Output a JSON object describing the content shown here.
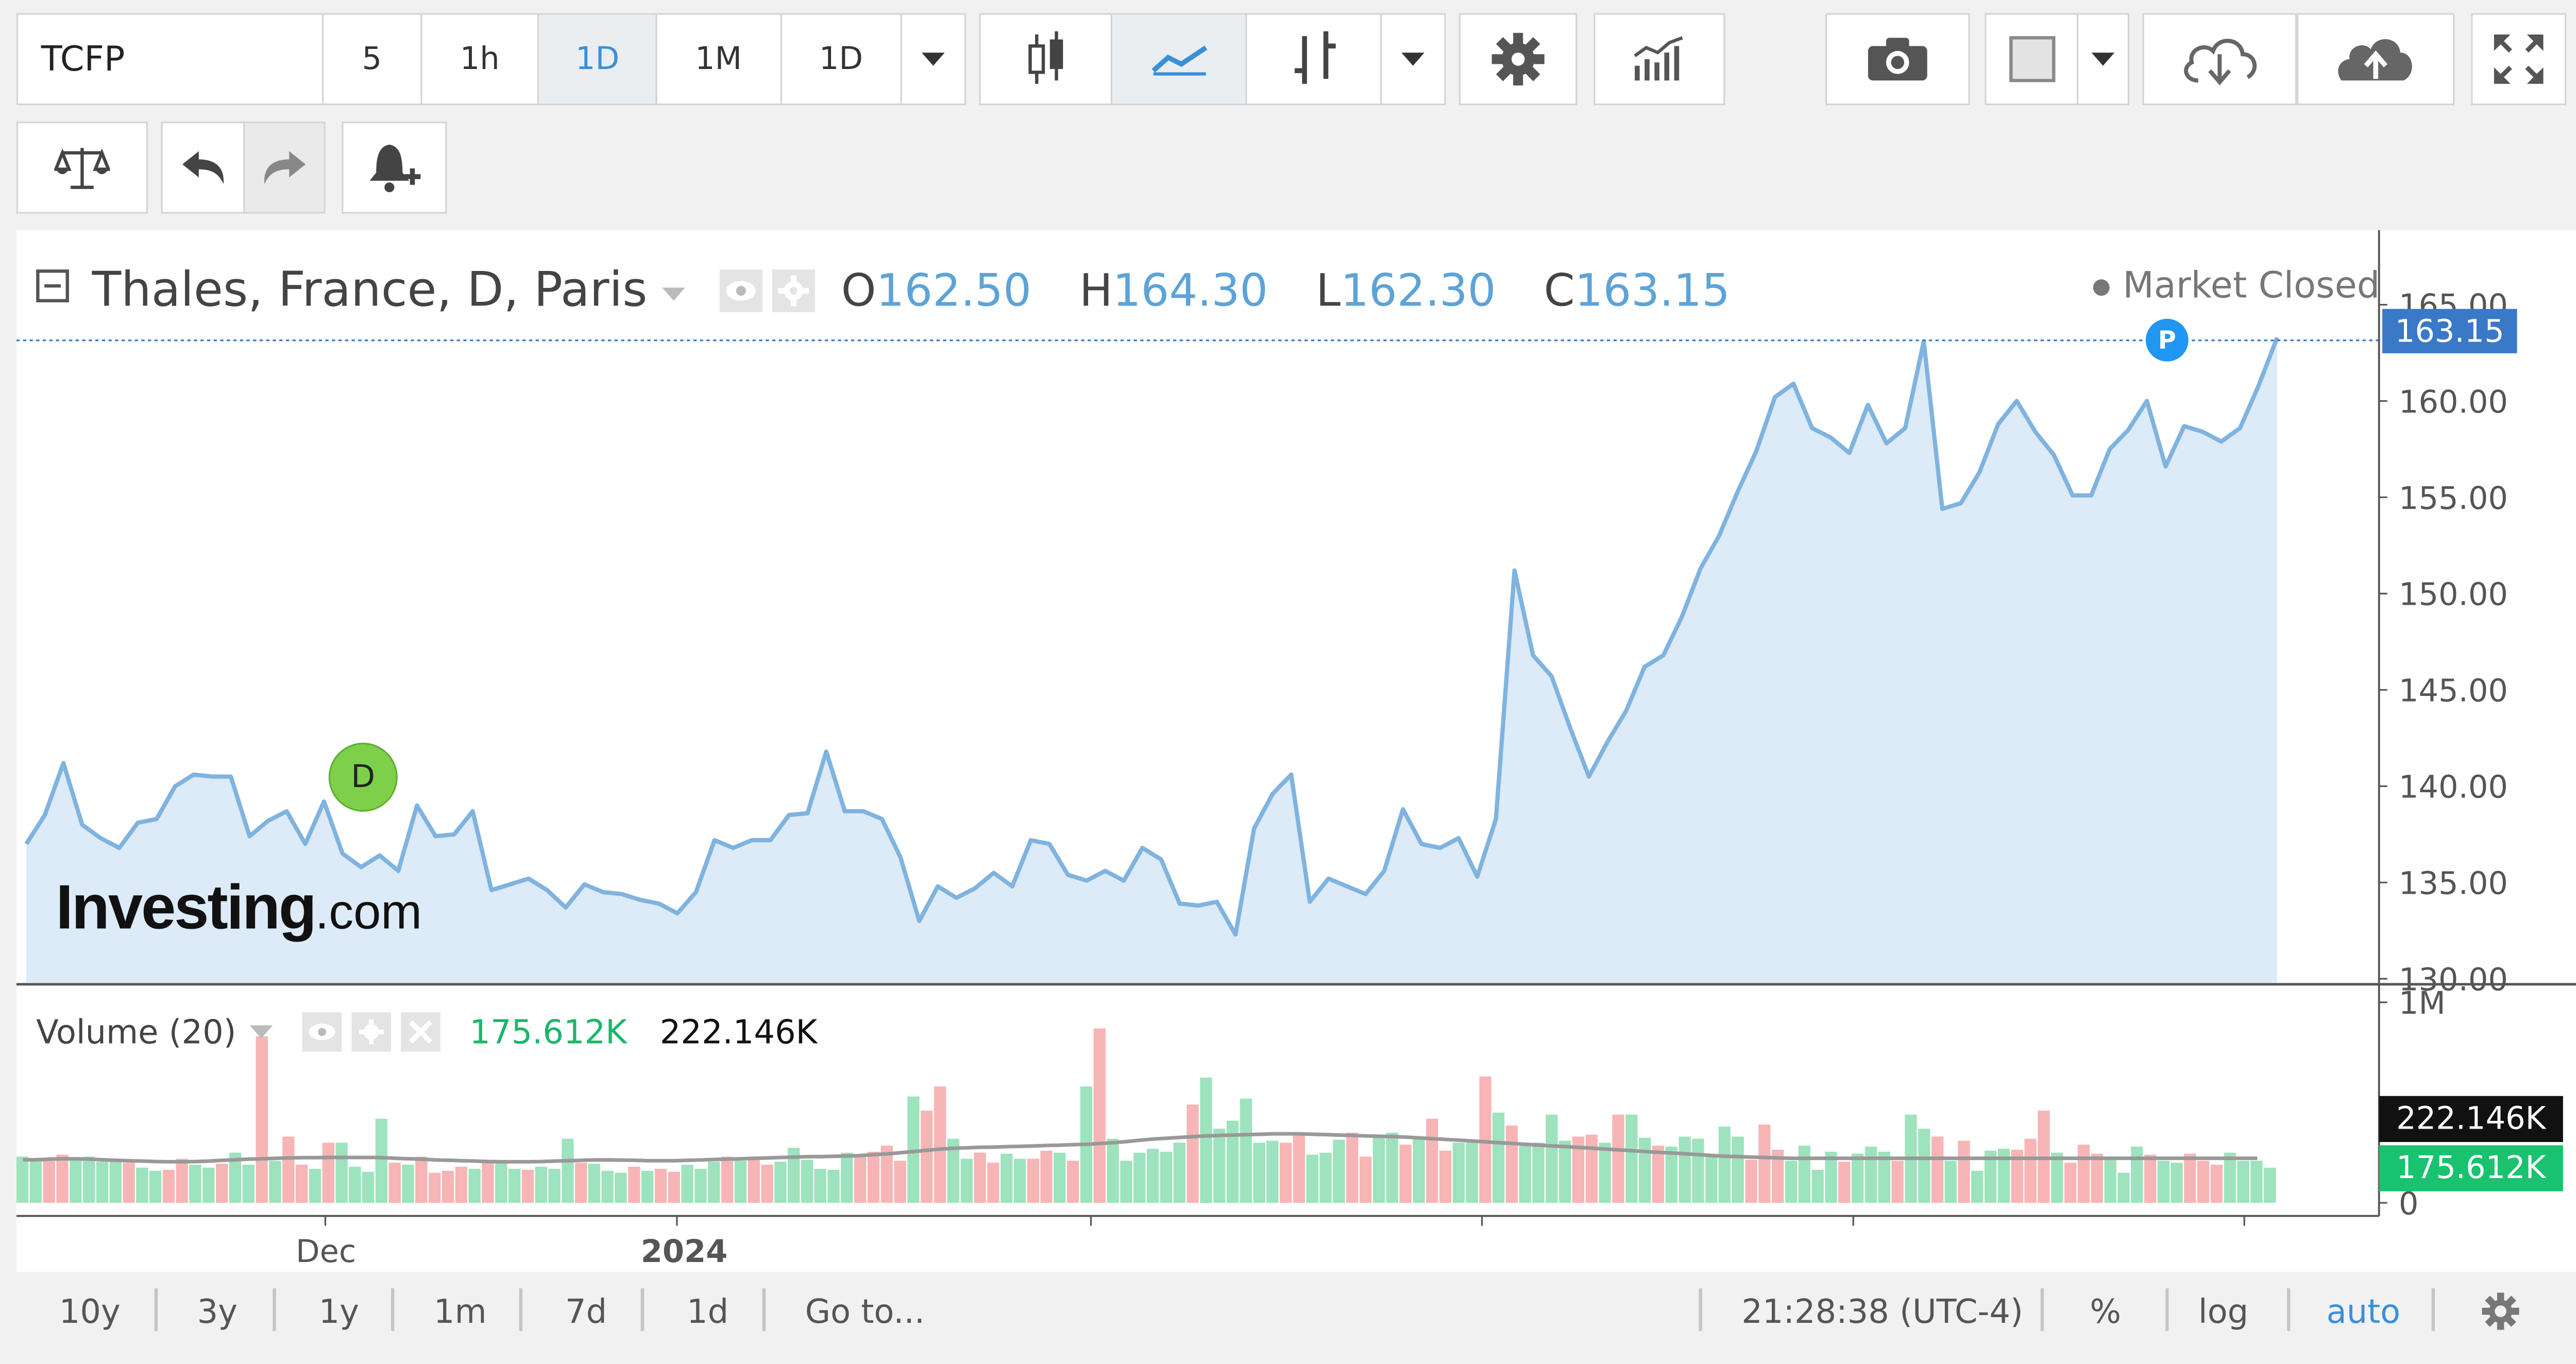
{
  "toolbar": {
    "symbol": "TCFP",
    "intervals": [
      "5",
      "1h",
      "1D",
      "1M",
      "1D"
    ],
    "active_interval_index": 2,
    "icons": [
      "candlestick-icon",
      "line-chart-icon",
      "bar-chart-icon",
      "chevron-down-icon",
      "gear-icon",
      "indicators-icon",
      "camera-icon",
      "color-swatch-icon",
      "chevron-down-icon",
      "cloud-download-icon",
      "cloud-upload-icon",
      "fullscreen-icon",
      "scales-icon",
      "undo-icon",
      "redo-icon",
      "add-alert-icon"
    ]
  },
  "legend": {
    "title": "Thales, France, D, Paris",
    "o_label": "O",
    "o_value": "162.50",
    "h_label": "H",
    "h_value": "164.30",
    "l_label": "L",
    "l_value": "162.30",
    "c_label": "C",
    "c_value": "163.15",
    "market_status": "Market Closed"
  },
  "watermark": {
    "brand": "Investing",
    "suffix": ".com"
  },
  "volume_legend": {
    "label": "Volume (20)",
    "value1": "175.612K",
    "value2": "222.146K"
  },
  "markers": {
    "d_label": "D",
    "p_label": "P"
  },
  "price_badge": "163.15",
  "volume_badges": {
    "ma": "222.146K",
    "last": "175.612K"
  },
  "bottom": {
    "ranges": [
      "10y",
      "3y",
      "1y",
      "1m",
      "7d",
      "1d"
    ],
    "goto": "Go to...",
    "time": "21:28:38 (UTC-4)",
    "percent": "%",
    "log": "log",
    "auto": "auto"
  },
  "colors": {
    "line": "#7fb3e0",
    "area": "#ddeaf7",
    "vol_up": "#9de3bd",
    "vol_down": "#f7b5b5",
    "accent": "#3a8fd9",
    "green_badge": "#19c26e"
  },
  "chart_data": [
    {
      "type": "area",
      "title": "Thales, France, D, Paris",
      "y_ticks": [
        "165.00",
        "160.00",
        "155.00",
        "150.00",
        "145.00",
        "140.00",
        "135.00",
        "130.00"
      ],
      "ylim": [
        129.8,
        167.0
      ],
      "x_ticks": [
        "Dec",
        "2024"
      ],
      "last_value": 163.15,
      "close": [
        137.0,
        138.5,
        141.2,
        138.0,
        137.3,
        136.8,
        138.1,
        138.3,
        140.0,
        140.6,
        140.5,
        140.5,
        137.4,
        138.2,
        138.7,
        137.0,
        139.2,
        136.5,
        135.8,
        136.4,
        135.6,
        139.0,
        137.4,
        137.5,
        138.7,
        134.6,
        134.9,
        135.2,
        134.6,
        133.7,
        134.9,
        134.5,
        134.4,
        134.1,
        133.9,
        133.4,
        134.5,
        137.2,
        136.8,
        137.2,
        137.2,
        138.5,
        138.6,
        141.8,
        138.7,
        138.7,
        138.3,
        136.3,
        133.0,
        134.8,
        134.2,
        134.7,
        135.5,
        134.8,
        137.2,
        137.0,
        135.4,
        135.1,
        135.6,
        135.1,
        136.8,
        136.2,
        133.9,
        133.8,
        134.0,
        132.3,
        137.8,
        139.6,
        140.6,
        134.0,
        135.2,
        134.8,
        134.4,
        135.6,
        138.8,
        137.0,
        136.8,
        137.3,
        135.3,
        138.3,
        151.2,
        146.8,
        145.7,
        143.0,
        140.5,
        142.3,
        143.9,
        146.2,
        146.8,
        148.8,
        151.3,
        153.0,
        155.3,
        157.4,
        160.2,
        160.9,
        158.6,
        158.1,
        157.3,
        159.8,
        157.8,
        158.6,
        163.1,
        154.4,
        154.7,
        156.3,
        158.8,
        160.0,
        158.4,
        157.2,
        155.1,
        155.1,
        157.5,
        158.5,
        160.0,
        156.6,
        158.7,
        158.4,
        157.9,
        158.6,
        160.8,
        163.3
      ],
      "volume_scale_max": 1000000,
      "volume_ma_value": 222146,
      "volume_last_value": 175612
    },
    {
      "type": "bar",
      "title": "Volume (20)",
      "y_ticks": [
        "1M",
        "0"
      ],
      "ylim": [
        0,
        1000000
      ],
      "volume_k": [
        230,
        210,
        215,
        240,
        225,
        230,
        205,
        210,
        200,
        175,
        160,
        165,
        220,
        190,
        175,
        195,
        250,
        190,
        830,
        210,
        330,
        190,
        170,
        300,
        300,
        180,
        155,
        420,
        200,
        190,
        230,
        150,
        160,
        180,
        170,
        200,
        200,
        170,
        165,
        180,
        170,
        320,
        200,
        195,
        160,
        150,
        180,
        160,
        170,
        155,
        190,
        170,
        205,
        230,
        210,
        215,
        190,
        205,
        275,
        215,
        170,
        165,
        250,
        240,
        255,
        285,
        210,
        530,
        460,
        580,
        320,
        220,
        250,
        200,
        245,
        220,
        220,
        260,
        250,
        210,
        580,
        870,
        320,
        210,
        250,
        270,
        255,
        300,
        490,
        625,
        370,
        410,
        520,
        300,
        310,
        300,
        335,
        240,
        250,
        315,
        350,
        230,
        330,
        350,
        290,
        330,
        420,
        260,
        300,
        310,
        630,
        450,
        385,
        295,
        300,
        440,
        310,
        330,
        340,
        300,
        440,
        440,
        325,
        285,
        280,
        330,
        320,
        240,
        380,
        330,
        215,
        390,
        265,
        210,
        285,
        165,
        255,
        205,
        245,
        280,
        255,
        210,
        440,
        370,
        330,
        210,
        310,
        160,
        260,
        270,
        265,
        320,
        460,
        250,
        200,
        290,
        245,
        220,
        150,
        280,
        240,
        210,
        200,
        245,
        210,
        190,
        250,
        210,
        210,
        175
      ],
      "direction": [
        1,
        1,
        -1,
        -1,
        1,
        1,
        1,
        1,
        -1,
        1,
        1,
        -1,
        -1,
        1,
        1,
        -1,
        1,
        1,
        -1,
        1,
        -1,
        -1,
        1,
        -1,
        1,
        1,
        1,
        1,
        -1,
        1,
        -1,
        -1,
        -1,
        -1,
        1,
        -1,
        1,
        1,
        -1,
        1,
        1,
        1,
        -1,
        1,
        1,
        1,
        -1,
        1,
        -1,
        -1,
        1,
        1,
        1,
        -1,
        1,
        -1,
        -1,
        1,
        1,
        1,
        1,
        1,
        1,
        -1,
        -1,
        -1,
        -1,
        1,
        -1,
        -1,
        1,
        1,
        -1,
        -1,
        1,
        1,
        -1,
        -1,
        1,
        -1,
        1,
        -1,
        1,
        1,
        1,
        1,
        1,
        1,
        -1,
        1,
        1,
        1,
        1,
        1,
        1,
        -1,
        -1,
        1,
        1,
        1,
        -1,
        -1,
        1,
        1,
        -1,
        1,
        -1,
        -1,
        1,
        1,
        -1,
        1,
        -1,
        1,
        1,
        1,
        1,
        -1,
        -1,
        1,
        -1,
        1,
        1,
        -1,
        1,
        1,
        1,
        1,
        1,
        1,
        -1,
        -1,
        -1,
        1,
        1,
        1,
        1,
        -1,
        1,
        1,
        1,
        -1,
        1,
        1,
        -1,
        1,
        -1,
        1,
        1,
        1,
        -1,
        -1,
        -1,
        1,
        -1,
        -1,
        -1,
        1,
        1,
        1,
        -1,
        1,
        1,
        -1,
        -1,
        -1,
        1,
        1,
        1,
        1,
        1
      ],
      "ma_k": [
        215,
        215,
        218,
        220,
        220,
        218,
        215,
        212,
        210,
        208,
        206,
        205,
        205,
        206,
        208,
        212,
        215,
        218,
        220,
        222,
        224,
        225,
        225,
        226,
        226,
        226,
        226,
        225,
        222,
        220,
        218,
        214,
        212,
        210,
        208,
        206,
        205,
        205,
        205,
        206,
        208,
        210,
        212,
        214,
        214,
        213,
        212,
        210,
        210,
        210,
        212,
        214,
        216,
        218,
        220,
        222,
        224,
        226,
        228,
        230,
        230,
        232,
        234,
        236,
        240,
        244,
        250,
        256,
        262,
        268,
        272,
        275,
        277,
        278,
        280,
        282,
        284,
        286,
        288,
        290,
        292,
        296,
        300,
        306,
        312,
        318,
        322,
        326,
        330,
        334,
        336,
        338,
        340,
        342,
        344,
        344,
        344,
        342,
        340,
        338,
        336,
        334,
        332,
        330,
        328,
        324,
        320,
        316,
        312,
        308,
        304,
        300,
        296,
        292,
        288,
        284,
        280,
        276,
        272,
        268,
        264,
        260,
        256,
        252,
        248,
        244,
        240,
        236,
        232,
        230,
        228,
        226,
        224,
        222,
        222,
        222,
        222,
        222,
        222,
        222,
        222,
        222,
        222,
        222,
        222,
        222,
        222,
        222,
        222,
        222,
        222,
        222,
        222,
        222,
        222,
        222,
        222,
        222,
        222,
        222,
        222,
        222,
        222,
        222,
        222,
        222,
        222,
        222,
        222
      ]
    }
  ]
}
